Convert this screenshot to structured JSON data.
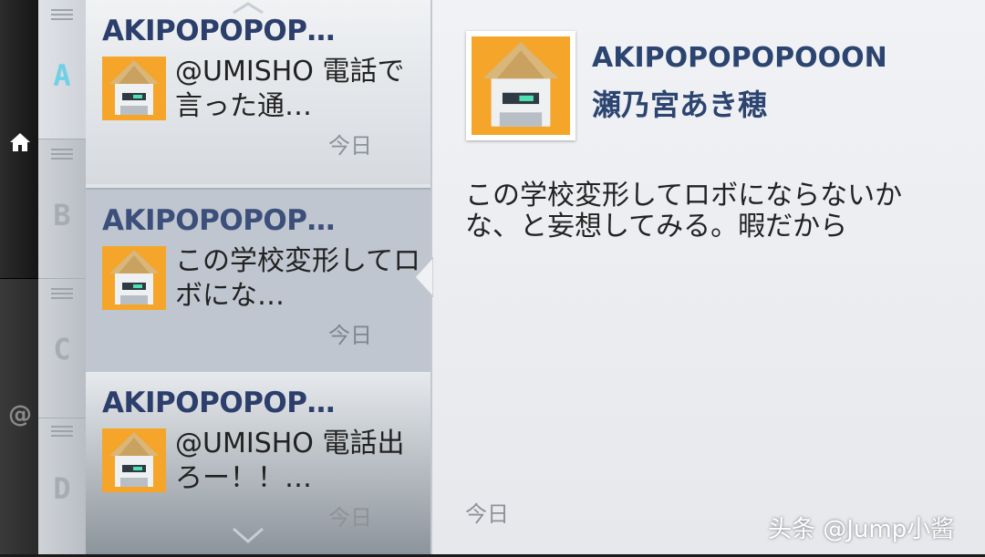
{
  "nav": {
    "home_icon": "home-icon",
    "mentions_icon": "at-icon",
    "mentions_symbol": "@"
  },
  "index": {
    "letters": [
      "A",
      "B",
      "C",
      "D"
    ],
    "active": "A",
    "accent": "#6fd0e6"
  },
  "tweets": [
    {
      "user": "AKIPOPOPOP…",
      "text": "@UMISHO 電話で言った通…",
      "time": "今日"
    },
    {
      "user": "AKIPOPOPOP…",
      "text": "この学校変形してロボにな…",
      "time": "今日"
    },
    {
      "user": "AKIPOPOPOP…",
      "text": "@UMISHO 電話出ろー！！…",
      "time": "今日"
    }
  ],
  "detail": {
    "screen_name": "AKIPOPOPOPOOON",
    "real_name": "瀬乃宮あき穂",
    "text": "この学校変形してロボにならないかな、と妄想してみる。暇だから",
    "time": "今日"
  },
  "watermark": "头条 @Jump小酱"
}
